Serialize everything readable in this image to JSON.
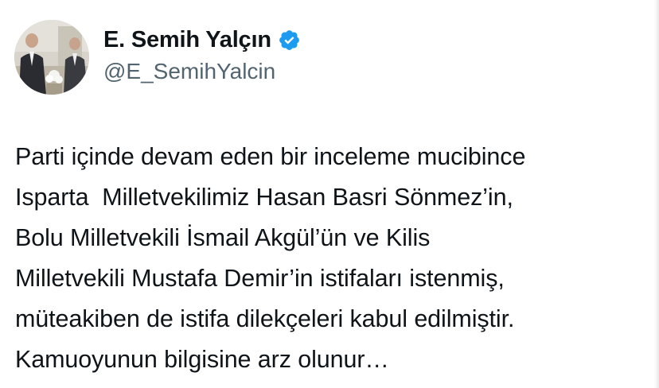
{
  "author": {
    "display_name": "E. Semih Yalçın",
    "handle": "@E_SemihYalcin",
    "verified": true,
    "avatar_icon": "profile-photo"
  },
  "tweet": {
    "lines": [
      "Parti içinde devam eden bir inceleme mucibince",
      "Isparta  Milletvekilimiz Hasan Basri Sönmez’in,",
      "Bolu Milletvekili İsmail Akgül’ün ve Kilis",
      "Milletvekili Mustafa Demir’in istifaları istenmiş,",
      "müteakiben de istifa dilekçeleri kabul edilmiştir.",
      "Kamuoyunun bilgisine arz olunur…"
    ]
  },
  "colors": {
    "text": "#0f1419",
    "secondary_text": "#536471",
    "verified_badge": "#1d9bf0",
    "background": "#ffffff"
  }
}
